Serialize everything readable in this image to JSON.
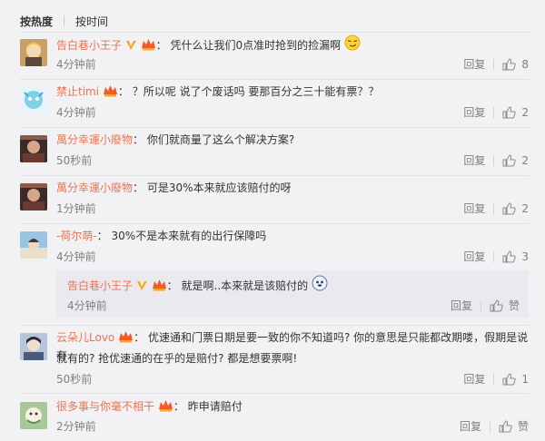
{
  "sort": {
    "hot": "按热度",
    "time": "按时间"
  },
  "actions": {
    "reply": "回复"
  },
  "colors": {
    "username": "#eb7350",
    "meta": "#808080",
    "bg": "#f2f2f5",
    "reply_bg": "#eaeaee"
  },
  "comments": [
    {
      "user": "告白巷小王子",
      "text": "凭什么让我们0点准时抢到的捡漏啊",
      "time": "4分钟前",
      "likes": "8",
      "badges": [
        "verified-v-icon",
        "vip-crown-icon"
      ],
      "emoji": "smirk-emoji-icon"
    },
    {
      "user": "禁止timi",
      "text": "？所以呢 说了个废话吗 要那百分之三十能有票？？",
      "time": "4分钟前",
      "likes": "2",
      "badges": [
        "vip-crown-icon"
      ]
    },
    {
      "user": "萬分幸運小廢物",
      "text": "你们就商量了这么个解决方案?",
      "time": "50秒前",
      "likes": "2"
    },
    {
      "user": "萬分幸運小廢物",
      "text": "可是30%本来就应该赔付的呀",
      "time": "1分钟前",
      "likes": "2"
    },
    {
      "user": "-荷尔萌-",
      "text": "30%不是本来就有的出行保障吗",
      "time": "4分钟前",
      "likes": "3"
    },
    {
      "user": "云朵儿Lovo",
      "text": "优速通和门票日期是要一致的你不知道吗? 你的意思是只能都改期喽，假期是说有",
      "text2": "就有的? 抢优速通的在乎的是赔付? 都是想要票啊!",
      "time": "50秒前",
      "likes": "1",
      "badges": [
        "vip-crown-icon"
      ]
    },
    {
      "user": "很多事与你毫不相干",
      "text": "昨申请赔付",
      "time": "2分钟前",
      "likes": "赞",
      "badges": [
        "vip-crown-icon"
      ]
    }
  ],
  "reply": {
    "user": "告白巷小王子",
    "text": "就是啊..本来就是该赔付的",
    "time": "4分钟前",
    "likes": "赞",
    "badges": [
      "verified-v-icon",
      "vip-crown-icon"
    ],
    "emoji": "doge-emoji-icon"
  }
}
